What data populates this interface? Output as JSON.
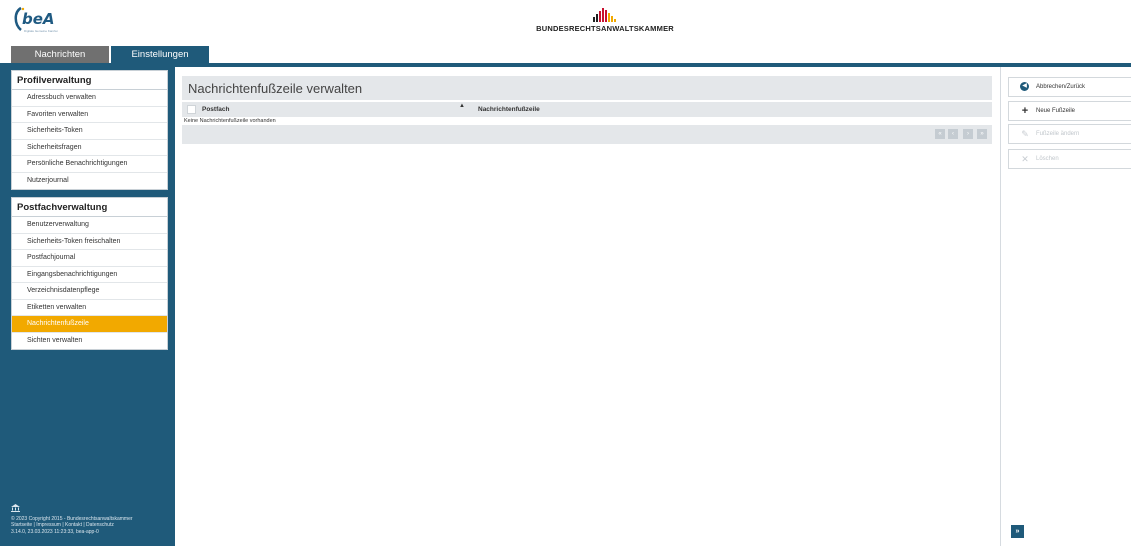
{
  "header": {
    "app_logo_text": "beA",
    "app_logo_subtitle": "Digitale Gemeine Kanzlei",
    "org_name": "BUNDESRECHTSANWALTSKAMMER"
  },
  "tabs": [
    {
      "label": "Nachrichten"
    },
    {
      "label": "Einstellungen"
    }
  ],
  "sidebar": {
    "profile": {
      "title": "Profilverwaltung",
      "items": [
        {
          "label": "Adressbuch verwalten"
        },
        {
          "label": "Favoriten verwalten"
        },
        {
          "label": "Sicherheits-Token"
        },
        {
          "label": "Sicherheitsfragen"
        },
        {
          "label": "Persönliche Benachrichtigungen"
        },
        {
          "label": "Nutzerjournal"
        }
      ]
    },
    "mailbox": {
      "title": "Postfachverwaltung",
      "items": [
        {
          "label": "Benutzerverwaltung"
        },
        {
          "label": "Sicherheits-Token freischalten"
        },
        {
          "label": "Postfachjournal"
        },
        {
          "label": "Eingangsbenachrichtigungen"
        },
        {
          "label": "Verzeichnisdatenpflege"
        },
        {
          "label": "Etiketten verwalten"
        },
        {
          "label": "Nachrichtenfußzeile"
        },
        {
          "label": "Sichten verwalten"
        }
      ]
    },
    "footer": {
      "copyright": "© 2023 Copyright 2015 - Bundesrechtsanwaltskammer",
      "links": "Startseite | Impressum | Kontakt | Datenschutz",
      "version": "3.14.0, 23.03.2023 11:23:33, bea-app-0"
    }
  },
  "main": {
    "title": "Nachrichtenfußzeile verwalten",
    "columns": [
      "Postfach",
      "Nachrichtenfußzeile"
    ],
    "sort_indicator": "▲",
    "empty_text": "Keine Nachrichtenfußzeile vorhanden",
    "pager": [
      "«",
      "‹",
      "›",
      "»"
    ]
  },
  "actions": [
    {
      "label": "Abbrechen/Zurück",
      "icon": "arrow-left-circle-icon",
      "enabled": true
    },
    {
      "label": "Neue Fußzeile",
      "icon": "plus-icon",
      "enabled": true
    },
    {
      "label": "Fußzeile ändern",
      "icon": "pencil-icon",
      "enabled": false
    },
    {
      "label": "Löschen",
      "icon": "x-icon",
      "enabled": false
    }
  ],
  "expand_button": "»",
  "colors": {
    "brand_blue": "#1f5a7a",
    "active_item": "#f2a900",
    "tab_inactive": "#707070",
    "panel_grey": "#e4e7ea"
  }
}
